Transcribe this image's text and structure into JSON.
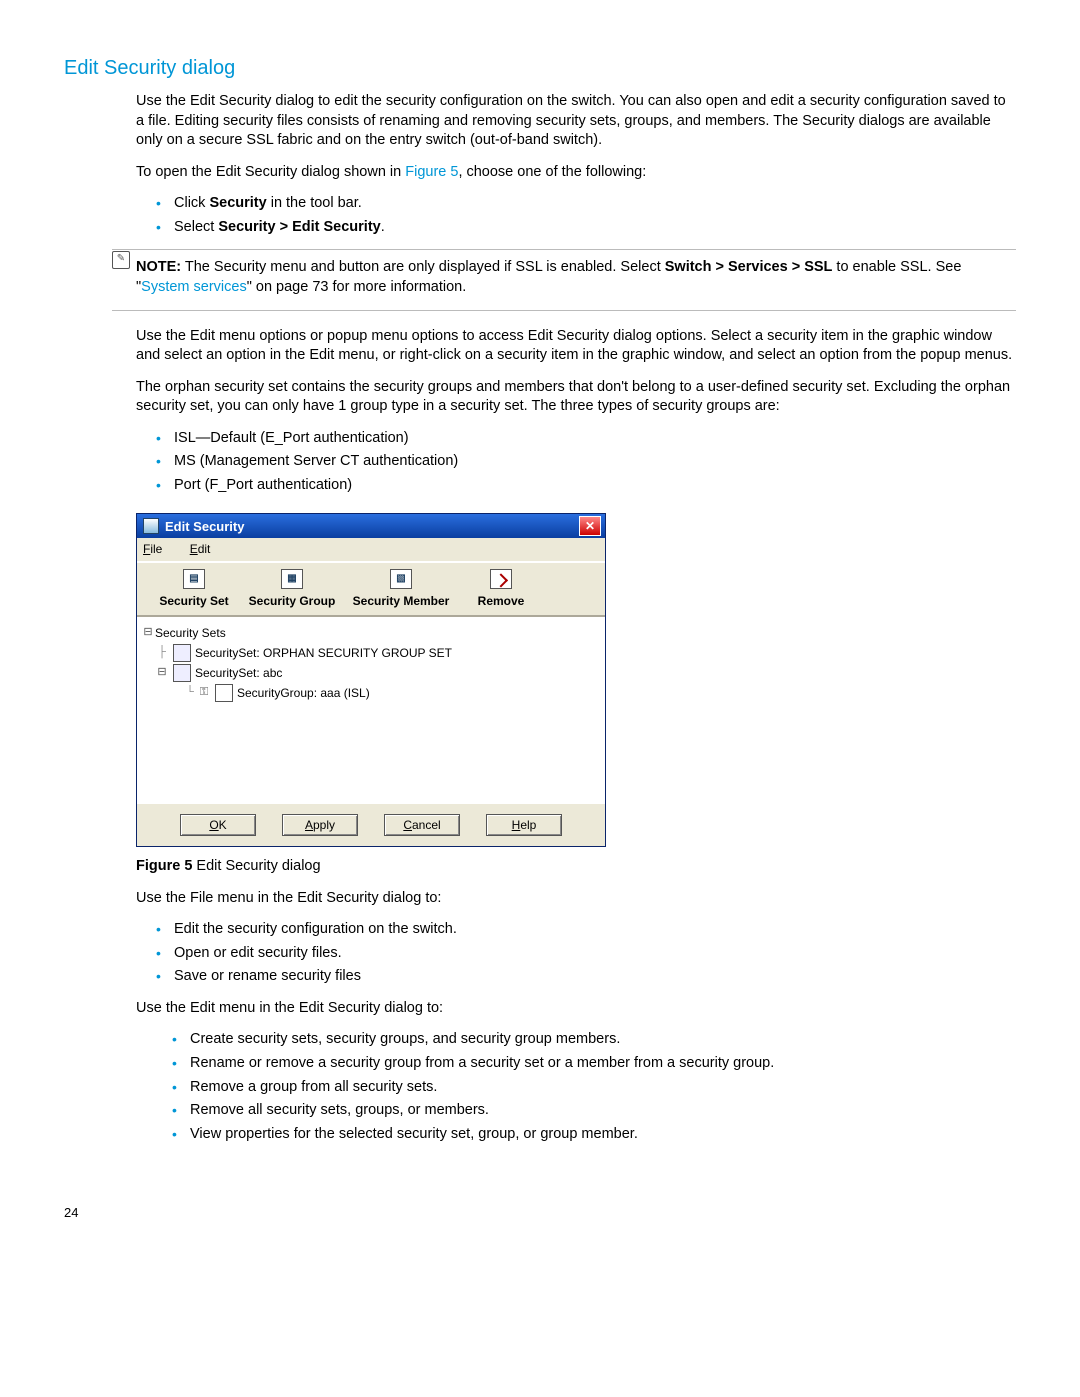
{
  "heading": "Edit Security dialog",
  "para1": "Use the Edit Security dialog to edit the security configuration on the switch. You can also open and edit a security configuration saved to a file. Editing security files consists of renaming and removing security sets, groups, and members. The Security dialogs are available only on a secure SSL fabric and on the entry switch (out-of-band switch).",
  "para2_a": "To open the Edit Security dialog shown in ",
  "para2_link": "Figure 5",
  "para2_b": ", choose one of the following:",
  "open_list": {
    "i1_a": "Click ",
    "i1_b": "Security",
    "i1_c": " in the tool bar.",
    "i2_a": "Select ",
    "i2_b": "Security > Edit Security",
    "i2_c": "."
  },
  "note": {
    "label": "NOTE:",
    "t1": "The Security menu and button are only displayed if SSL is enabled. Select ",
    "bold1": "Switch > Services > SSL",
    "t2": " to enable SSL. See \"",
    "link": "System services",
    "t3": "\" on page 73 for more information."
  },
  "para3": "Use the Edit menu options or popup menu options to access Edit Security dialog options. Select a security item in the graphic window and select an option in the Edit menu, or right-click on a security item in the graphic window, and select an option from the popup menus.",
  "para4": "The orphan security set contains the security groups and members that don't belong to a user-defined security set. Excluding the orphan security set, you can only have 1 group type in a security set. The three types of security groups are:",
  "group_types": {
    "i1": "ISL—Default (E_Port authentication)",
    "i2": "MS (Management Server CT authentication)",
    "i3": "Port (F_Port authentication)"
  },
  "dialog": {
    "title": "Edit Security",
    "menu_file": "File",
    "menu_edit": "Edit",
    "tool1": "Security Set",
    "tool2": "Security Group",
    "tool3": "Security Member",
    "tool4": "Remove",
    "tree_root": "Security Sets",
    "tree_n1": "SecuritySet: ORPHAN SECURITY GROUP SET",
    "tree_n2": "SecuritySet: abc",
    "tree_n3": "SecurityGroup: aaa (ISL)",
    "btn_ok": "OK",
    "btn_apply": "Apply",
    "btn_cancel": "Cancel",
    "btn_help": "Help"
  },
  "fig_caption_b": "Figure 5",
  "fig_caption_t": " Edit Security dialog",
  "para5": "Use the File menu in the Edit Security dialog to:",
  "file_menu_list": {
    "i1": "Edit the security configuration on the switch.",
    "i2": "Open or edit security files.",
    "i3": "Save or rename security files"
  },
  "para6": "Use the Edit menu in the Edit Security dialog to:",
  "edit_menu_list": {
    "i1": "Create security sets, security groups, and security group members.",
    "i2": "Rename or remove a security group from a security set or a member from a security group.",
    "i3": "Remove a group from all security sets.",
    "i4": "Remove all security sets, groups, or members.",
    "i5": "View properties for the selected security set, group, or group member."
  },
  "page_number": "24"
}
